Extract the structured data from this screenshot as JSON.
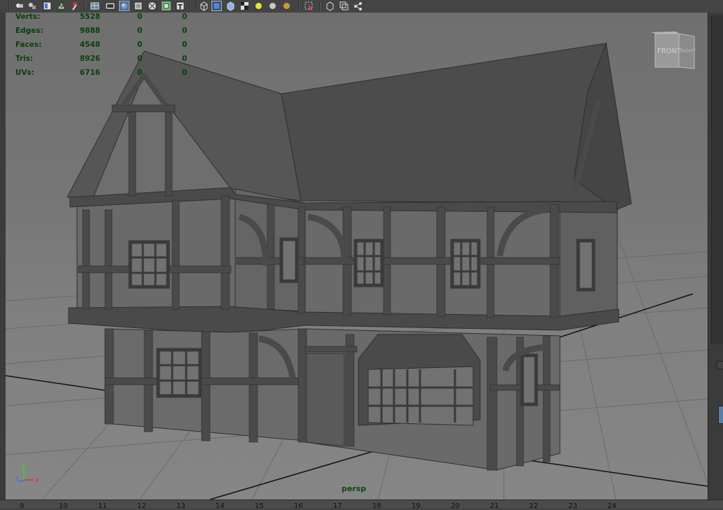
{
  "toolbar": {
    "icons": [
      "camera-attributes-icon",
      "bookmark-icon",
      "image-plane-icon",
      "2d-pan-icon",
      "grease-pencil-icon",
      "grid-icon",
      "film-gate-icon",
      "wireframe-icon",
      "smooth-shade-icon",
      "shaded-wireframe-icon",
      "textured-icon",
      "use-all-lights-icon",
      "text-icon",
      "bounding-box-icon",
      "shaded-cube-icon",
      "xray-icon",
      "checker-icon",
      "default-light-icon",
      "shadows-icon",
      "ambient-occlusion-icon",
      "select-camera-icon",
      "isolate-select-icon",
      "resolution-gate-icon",
      "node-editor-icon"
    ]
  },
  "hud": {
    "rows": [
      {
        "label": "Verts:",
        "value": "5528",
        "sel": "0",
        "uv": "0"
      },
      {
        "label": "Edges:",
        "value": "9888",
        "sel": "0",
        "uv": "0"
      },
      {
        "label": "Faces:",
        "value": "4548",
        "sel": "0",
        "uv": "0"
      },
      {
        "label": "Tris:",
        "value": "8926",
        "sel": "0",
        "uv": "0"
      },
      {
        "label": "UVs:",
        "value": "6716",
        "sel": "0",
        "uv": "0"
      }
    ]
  },
  "viewcube": {
    "front": "FRONT",
    "right": "RIGHT"
  },
  "axis": {
    "y": "y",
    "z": "z",
    "x": "x"
  },
  "camera_label": "persp",
  "timeline": {
    "ticks": [
      "9",
      "10",
      "11",
      "12",
      "13",
      "14",
      "15",
      "16",
      "17",
      "18",
      "19",
      "20",
      "21",
      "22",
      "23",
      "24"
    ]
  },
  "colors": {
    "hud_text": "#0b3f0b",
    "viewport_bg": "#777777",
    "model": "#4a4a4a"
  }
}
